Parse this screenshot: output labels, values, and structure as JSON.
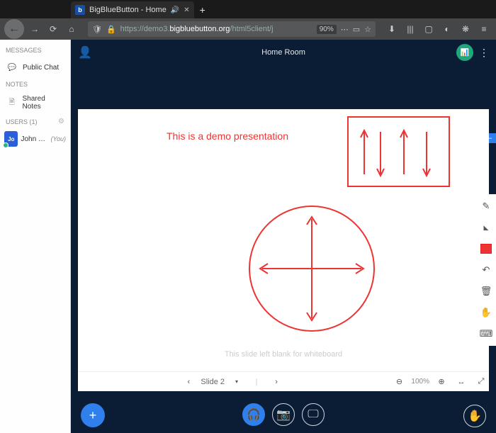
{
  "os": {
    "close": "✕",
    "min": "–",
    "max": "▢"
  },
  "browser": {
    "tab_title": "BigBlueButton - Home",
    "newtab_label": "+",
    "url_prefix": "https://demo3.",
    "url_domain": "bigbluebutton.org",
    "url_suffix": "/html5client/j",
    "zoom": "90%"
  },
  "sidebar": {
    "messages_label": "Messages",
    "public_chat": "Public Chat",
    "notes_label": "Notes",
    "shared_notes": "Shared Notes",
    "users_label": "Users (1)",
    "user": {
      "initials": "Jo",
      "name": "John Per...",
      "you": "(You)"
    }
  },
  "room": {
    "title": "Home Room"
  },
  "slide": {
    "demo_text": "This is a demo presentation",
    "blank_text": "This slide left blank for whiteboard",
    "label": "Slide 2",
    "dropdown_caret": "▾",
    "zoom": "100%"
  },
  "icons": {
    "back": "←",
    "fwd": "→",
    "reload": "⟳",
    "home": "⌂",
    "shield": "🛡",
    "lock": "🔒",
    "dots": "⋯",
    "reader": "▭",
    "star": "☆",
    "download": "⬇",
    "library": "|||",
    "tab_overview": "▢",
    "ext1": "◐",
    "ext2": "❋",
    "menu": "≡",
    "user": "👤",
    "kebab": "⋮",
    "analytics": "📊",
    "chat": "💬",
    "notes": "🗎",
    "gear": "⚙",
    "plus": "+",
    "audio": "🎧",
    "camera": "📷",
    "screen": "🖵",
    "hand": "✋",
    "slide_prev": "‹",
    "slide_next": "›",
    "divider": "|",
    "zoom_out": "⊖",
    "zoom_in": "⊕",
    "fit": "↔",
    "fullscreen": "⤢",
    "minimize": "–",
    "pencil": "✎",
    "pen_caret": "◣",
    "undo": "↶",
    "trash": "🗑",
    "hand_tool": "✋",
    "text_tool": "⌨"
  }
}
